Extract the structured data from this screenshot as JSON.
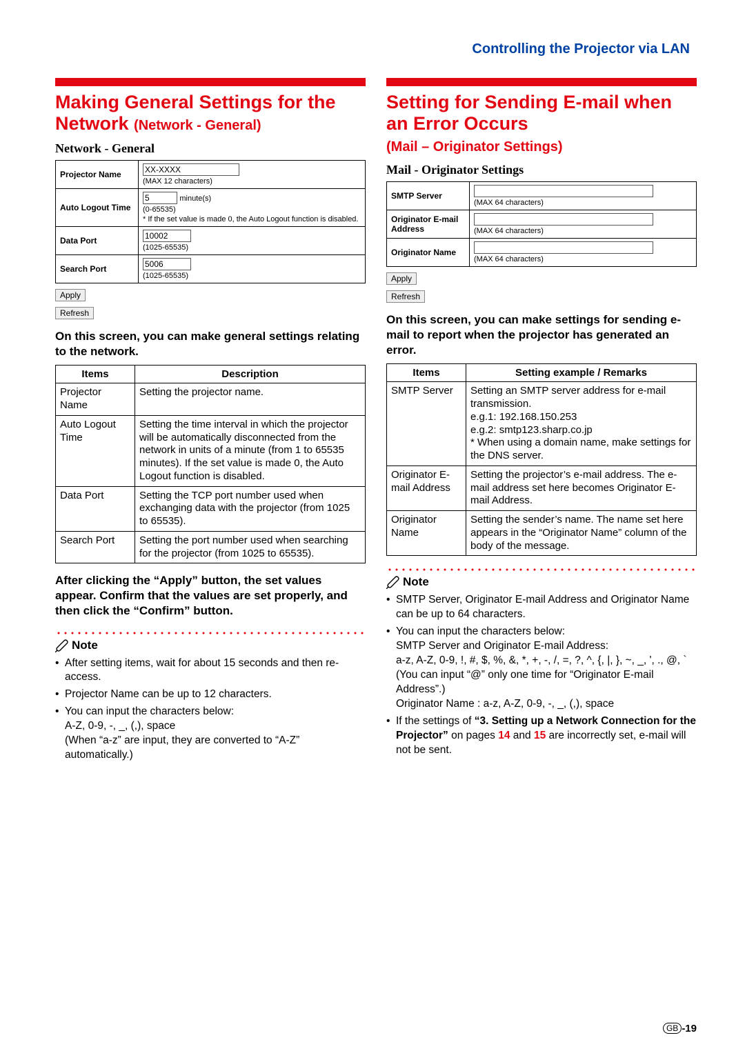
{
  "header": {
    "title": "Controlling the Projector via LAN"
  },
  "left": {
    "title_a": "Making General Settings for the Network",
    "title_sub": "(Network - General)",
    "panel": {
      "caption": "Network - General",
      "rows": {
        "projectorName": {
          "label": "Projector Name",
          "value": "XX-XXXX",
          "hint": "(MAX 12 characters)"
        },
        "autoLogout": {
          "label": "Auto Logout Time",
          "value": "5",
          "unit": "minute(s)",
          "hint": "(0-65535)",
          "note": "* If the set value is made 0, the Auto Logout function is disabled."
        },
        "dataPort": {
          "label": "Data Port",
          "value": "10002",
          "hint": "(1025-65535)"
        },
        "searchPort": {
          "label": "Search Port",
          "value": "5006",
          "hint": "(1025-65535)"
        }
      },
      "apply": "Apply",
      "refresh": "Refresh"
    },
    "lead": "On this screen, you can make general settings relating to the network.",
    "descHead": {
      "items": "Items",
      "desc": "Description"
    },
    "desc": [
      {
        "item": "Projector Name",
        "text": "Setting the projector name."
      },
      {
        "item": "Auto Logout Time",
        "text": "Setting the time interval in which the projector will be automatically disconnected from the network in units of a minute (from 1 to 65535 minutes). If the set value is made 0, the Auto Logout function is disabled."
      },
      {
        "item": "Data Port",
        "text": "Setting the TCP port number used when exchanging data with the projector (from 1025 to 65535)."
      },
      {
        "item": "Search Port",
        "text": "Setting the port number used when searching for the projector (from 1025 to 65535)."
      }
    ],
    "confirm": "After clicking the “Apply” button, the set values appear. Confirm that the values are set properly, and then click the “Confirm” button.",
    "noteLabel": "Note",
    "notes": {
      "n1": "After setting items, wait for about 15 seconds and then re-access.",
      "n2": "Projector Name can be up to 12 characters.",
      "n3a": "You can input the characters below:",
      "n3b": "A-Z, 0-9, -, _, (,), space",
      "n3c": "(When “a-z” are input, they are converted to “A-Z” automatically.)"
    }
  },
  "right": {
    "title_a": "Setting for Sending E-mail when an Error Occurs",
    "title_sub": "(Mail – Originator Settings)",
    "panel": {
      "caption": "Mail - Originator Settings",
      "rows": {
        "smtp": {
          "label": "SMTP Server",
          "hint": "(MAX 64 characters)"
        },
        "origEmail": {
          "label": "Originator E-mail Address",
          "hint": "(MAX 64 characters)"
        },
        "origName": {
          "label": "Originator Name",
          "hint": "(MAX 64 characters)"
        }
      },
      "apply": "Apply",
      "refresh": "Refresh"
    },
    "lead": "On this screen, you can make settings for sending e-mail to report when the projector has generated an error.",
    "descHead": {
      "items": "Items",
      "desc": "Setting example / Remarks"
    },
    "desc": [
      {
        "item": "SMTP Server",
        "text": "Setting an SMTP server address for e-mail transmission.\ne.g.1: 192.168.150.253\ne.g.2: smtp123.sharp.co.jp\n* When using a domain name, make settings for the DNS server."
      },
      {
        "item": "Originator E-mail Address",
        "text": "Setting the projector’s e-mail address. The e-mail address set here becomes Originator E-mail Address."
      },
      {
        "item": "Originator Name",
        "text": "Setting the sender’s name.  The name set here appears in the “Originator Name” column of the body of the message."
      }
    ],
    "noteLabel": "Note",
    "notes": {
      "n1": "SMTP Server, Originator E-mail Address and Originator Name can be up to 64 characters.",
      "n2a": "You can input the characters below:",
      "n2b": "SMTP Server and Originator E-mail Address:",
      "n2c": "a-z, A-Z, 0-9, !, #, $, %, &, *, +, -, /, =, ?, ^, {, |, }, ~, _, ', ., @, `",
      "n2d": "(You can input “@” only one time for “Originator E-mail Address”.)",
      "n2e": "Originator Name : a-z, A-Z, 0-9, -, _, (,), space",
      "n3a": "If the settings of ",
      "n3bold": "“3. Setting up a Network Connection for the Projector”",
      "n3b": " on pages ",
      "n3p1": "14",
      "n3c": " and ",
      "n3p2": "15",
      "n3d": " are incorrectly set, e-mail will not be sent."
    }
  },
  "footer": {
    "gb": "GB",
    "page": "-19"
  }
}
